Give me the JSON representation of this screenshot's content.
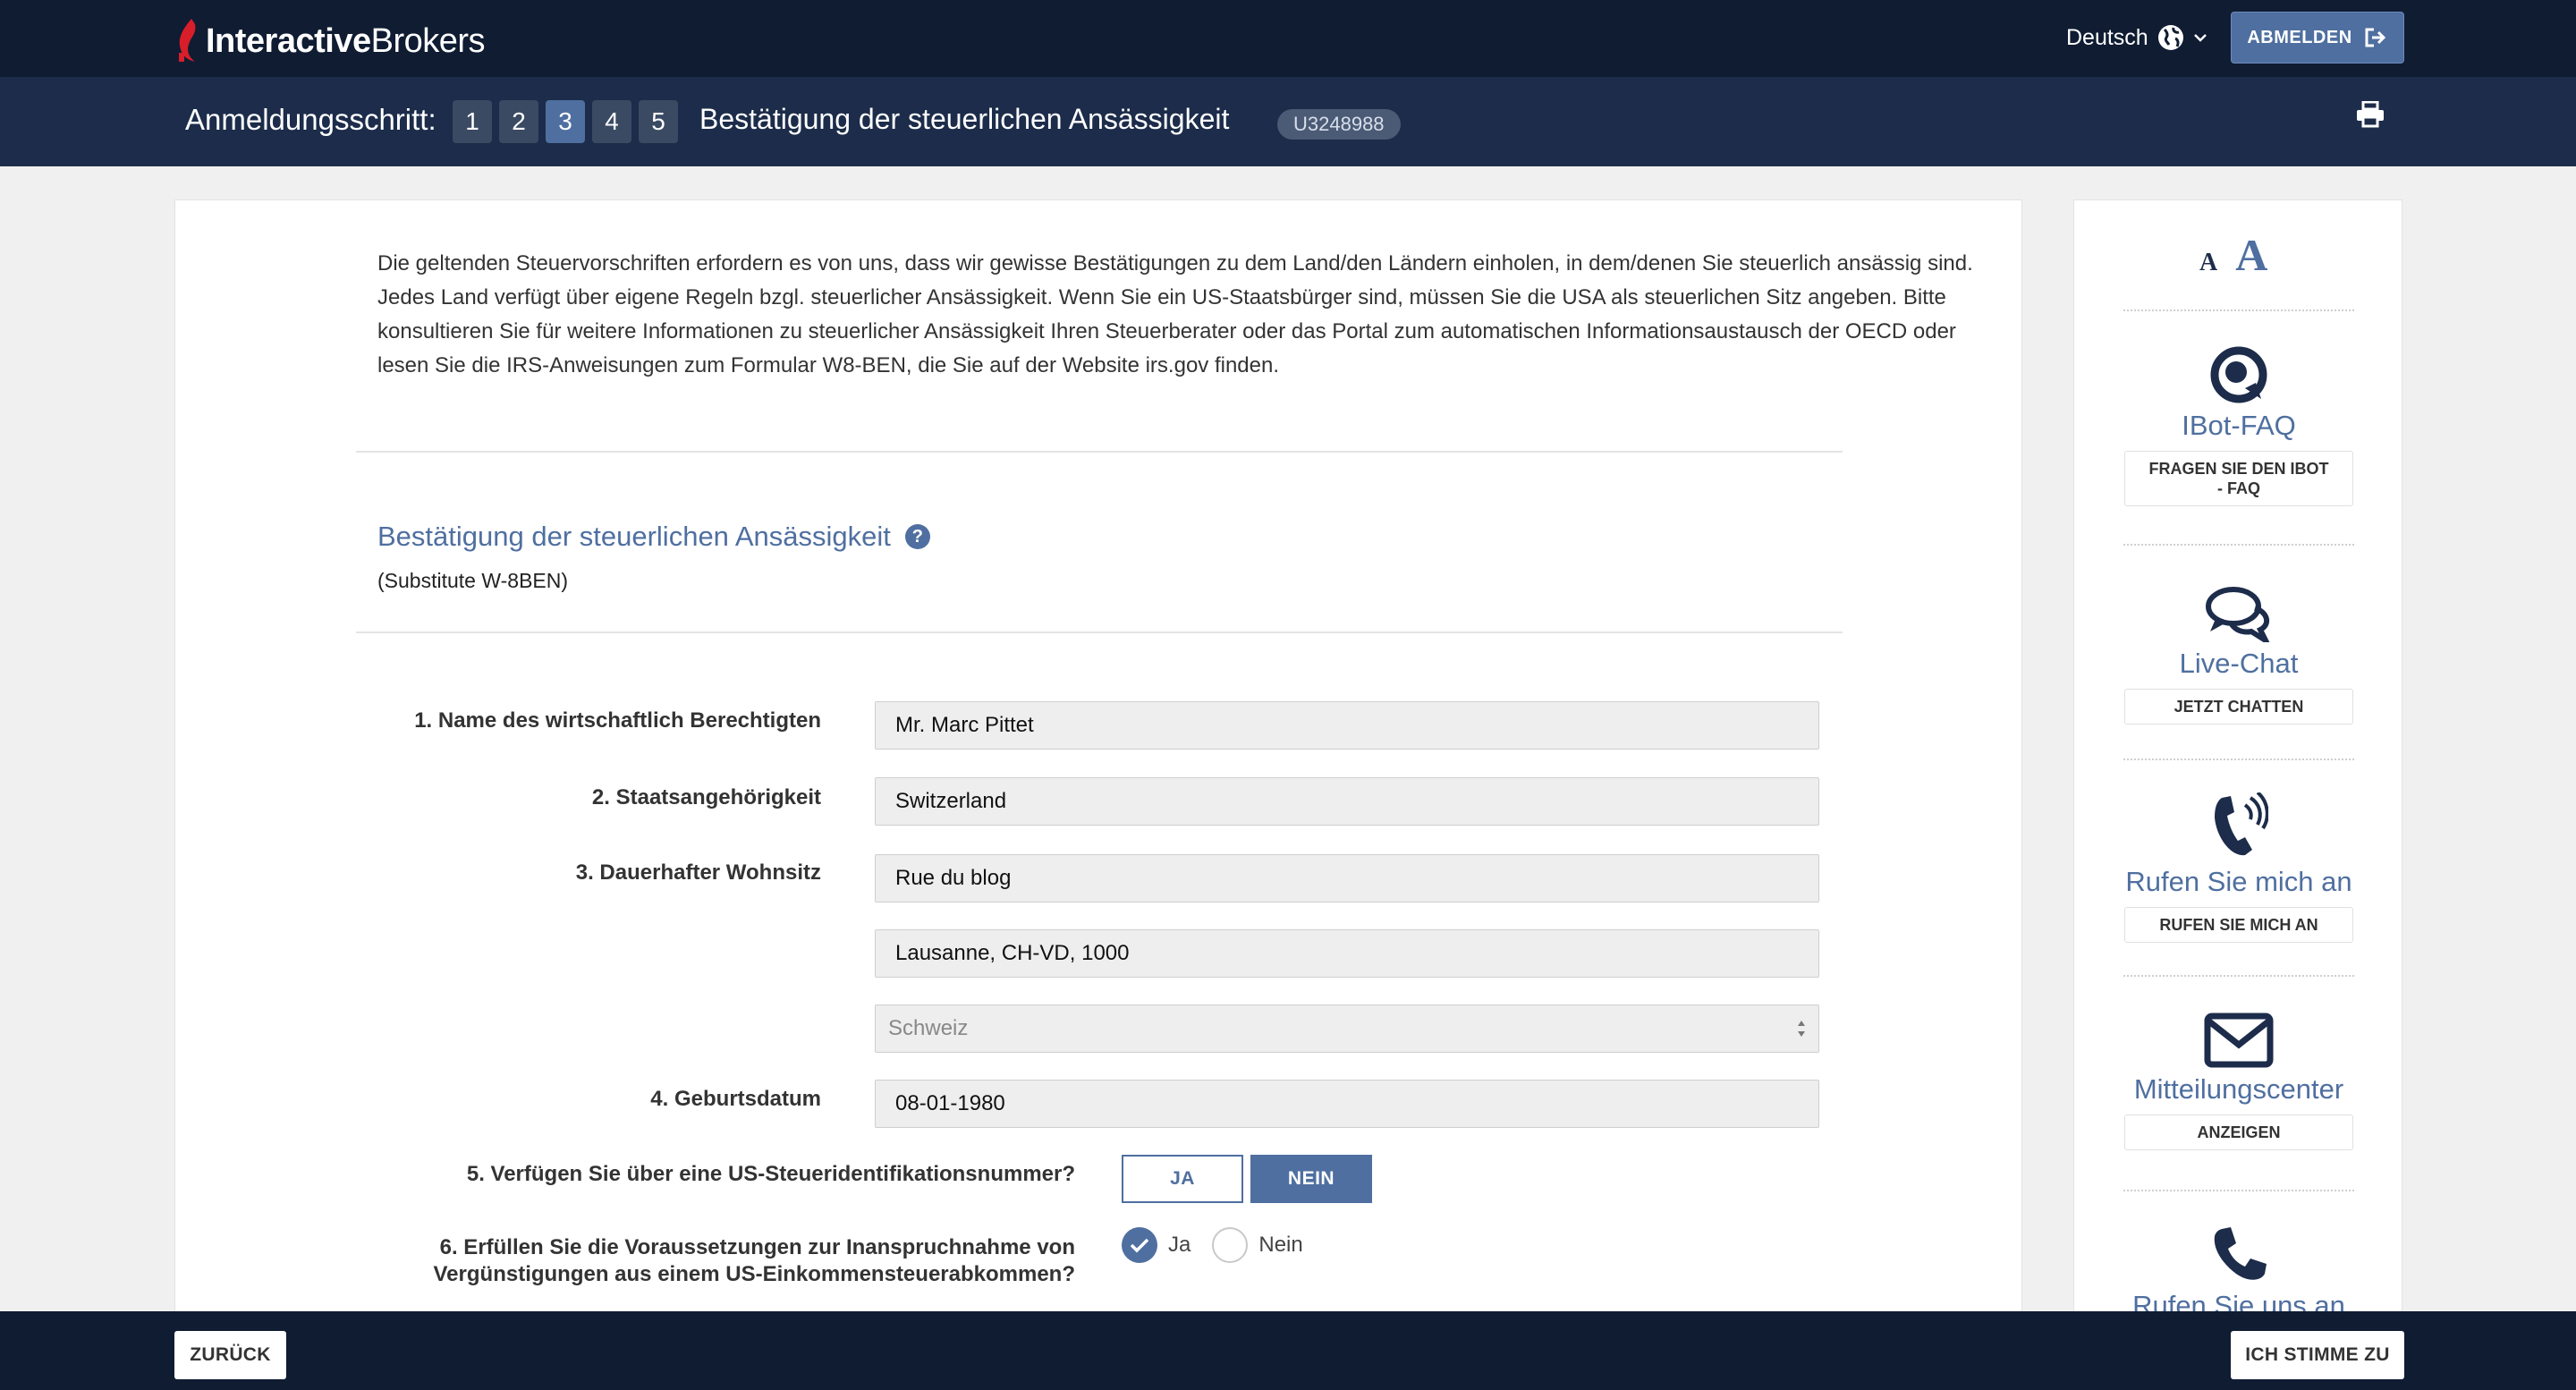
{
  "header": {
    "brand_bold": "Interactive",
    "brand_regular": "Brokers",
    "language": "Deutsch",
    "logout_label": "ABMELDEN"
  },
  "stepbar": {
    "label": "Anmeldungsschritt:",
    "steps": [
      "1",
      "2",
      "3",
      "4",
      "5"
    ],
    "active_step": "3",
    "title": "Bestätigung der steuerlichen Ansässigkeit",
    "account_id": "U3248988"
  },
  "main": {
    "intro": "Die geltenden Steuervorschriften erfordern es von uns, dass wir gewisse Bestätigungen zu dem Land/den Ländern einholen, in dem/denen Sie steuerlich ansässig sind. Jedes Land verfügt über eigene Regeln bzgl. steuerlicher Ansässigkeit. Wenn Sie ein US-Staatsbürger sind, müssen Sie die USA als steuerlichen Sitz angeben. Bitte konsultieren Sie für weitere Informationen zu steuerlicher Ansässigkeit Ihren Steuerberater oder das Portal zum automatischen Informationsaustausch der OECD oder lesen Sie die IRS-Anweisungen zum Formular W8-BEN, die Sie auf der Website irs.gov finden.",
    "section_title": "Bestätigung der steuerlichen Ansässigkeit",
    "section_subtitle": "(Substitute W-8BEN)",
    "fields": {
      "name_label": "1. Name des wirtschaftlich Berechtigten",
      "name_value": "Mr. Marc Pittet",
      "citizenship_label": "2. Staatsangehörigkeit",
      "citizenship_value": "Switzerland",
      "residence_label": "3. Dauerhafter Wohnsitz",
      "address_line1": "Rue du blog",
      "address_line2": "Lausanne, CH-VD, 1000",
      "country_value": "Schweiz",
      "dob_label": "4. Geburtsdatum",
      "dob_value": "08-01-1980",
      "tin_label": "5. Verfügen Sie über eine US-Steueridentifikationsnummer?",
      "tin_yes": "JA",
      "tin_no": "NEIN",
      "treaty_label_line1": "6. Erfüllen Sie die Voraussetzungen zur Inanspruchnahme von",
      "treaty_label_line2": "Vergünstigungen aus einem US-Einkommensteuerabkommen?",
      "treaty_yes": "Ja",
      "treaty_no": "Nein"
    }
  },
  "sidebar": {
    "font_small": "A",
    "font_large": "A",
    "items": [
      {
        "title": "IBot-FAQ",
        "button_line1": "FRAGEN SIE DEN IBOT",
        "button_line2": "- FAQ"
      },
      {
        "title": "Live-Chat",
        "button": "JETZT CHATTEN"
      },
      {
        "title": "Rufen Sie mich an",
        "button": "RUFEN SIE MICH AN"
      },
      {
        "title": "Mitteilungscenter",
        "button": "ANZEIGEN"
      },
      {
        "title": "Rufen Sie uns an"
      }
    ]
  },
  "footer": {
    "back_label": "ZURÜCK",
    "agree_label": "ICH STIMME ZU"
  },
  "colors": {
    "navy_dark": "#0f1c32",
    "navy": "#1c2c4a",
    "accent": "#4f6fa0",
    "brand_red": "#d81e2a"
  }
}
